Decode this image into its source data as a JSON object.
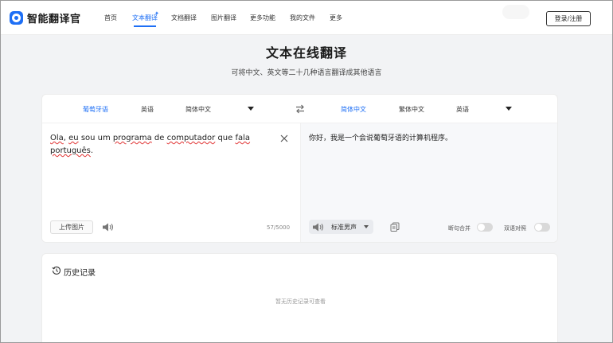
{
  "header": {
    "brand": "智能翻译官",
    "nav": [
      {
        "label": "首页"
      },
      {
        "label": "文本翻译",
        "active": true
      },
      {
        "label": "文档翻译"
      },
      {
        "label": "图片翻译"
      },
      {
        "label": "更多功能"
      },
      {
        "label": "我的文件"
      },
      {
        "label": "更多"
      }
    ],
    "login": "登录/注册"
  },
  "title": "文本在线翻译",
  "subtitle": "可将中文、英文等二十几种语言翻译成其他语言",
  "translator": {
    "source_langs": [
      "葡萄牙语",
      "英语",
      "简体中文"
    ],
    "source_active": "葡萄牙语",
    "target_langs": [
      "简体中文",
      "繁体中文",
      "英语"
    ],
    "target_active": "简体中文",
    "source_text_parts": [
      "Ola",
      ", ",
      "eu",
      " sou um ",
      "programa",
      " de ",
      "computador",
      " que ",
      "fala",
      " ",
      "português",
      "."
    ],
    "target_text": "你好，我是一个会说葡萄牙语的计算机程序。",
    "upload_label": "上传图片",
    "char_count": "57/5000",
    "voice": "标准男声",
    "toggle_1": "断句合并",
    "toggle_2": "双语对照"
  },
  "history": {
    "title": "历史记录",
    "empty": "暂无历史记录可查看"
  },
  "colors": {
    "accent": "#1e6ff5",
    "background": "#f2f3f5",
    "misspelling": "#e03030"
  }
}
